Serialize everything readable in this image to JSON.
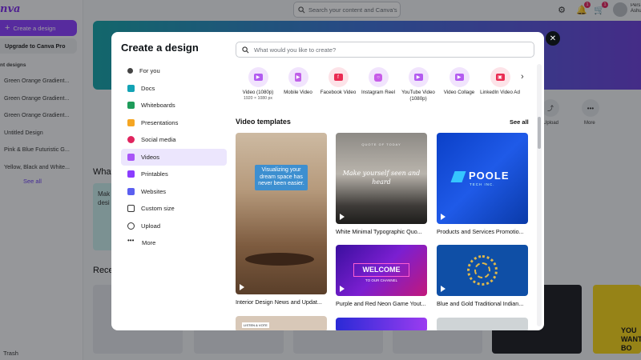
{
  "app": {
    "logo_text": "nva",
    "create_button": "Create a design",
    "upgrade_button": "Upgrade to Canva Pro",
    "recent_header": "nt designs",
    "recent_items": [
      "Green Orange Gradient...",
      "Green Orange Gradient...",
      "Green Orange Gradient...",
      "Untitled Design",
      "Pink & Blue Futuristic G...",
      "Yellow, Black and White..."
    ],
    "see_all": "See all",
    "trash": "Trash",
    "search_placeholder": "Search your content and Canva's",
    "notification_badges": [
      "1",
      "1"
    ],
    "account_name": "Pers\nAshu",
    "section_what": "What",
    "section_recent": "Rece",
    "what_card_text": "Mak\ndesi",
    "bg_shortcuts": [
      "Upload",
      "More"
    ],
    "yellow_card_text": "YOU\nWANT\nBO"
  },
  "modal": {
    "title": "Create a design",
    "search_placeholder": "What would you like to create?",
    "nav": [
      {
        "label": "For you",
        "icon": "sparkle-icon",
        "color": "#444444",
        "active": false
      },
      {
        "label": "Docs",
        "icon": "docs-icon",
        "color": "#13a3b5",
        "active": false
      },
      {
        "label": "Whiteboards",
        "icon": "whiteboard-icon",
        "color": "#1e9c5a",
        "active": false
      },
      {
        "label": "Presentations",
        "icon": "presentation-icon",
        "color": "#f5a623",
        "active": false
      },
      {
        "label": "Social media",
        "icon": "social-media-icon",
        "color": "#e0245e",
        "active": false
      },
      {
        "label": "Videos",
        "icon": "video-icon",
        "color": "#a855f7",
        "active": true
      },
      {
        "label": "Printables",
        "icon": "printer-icon",
        "color": "#8b3dff",
        "active": false
      },
      {
        "label": "Websites",
        "icon": "website-icon",
        "color": "#5b5ff0",
        "active": false
      },
      {
        "label": "Custom size",
        "icon": "custom-size-icon",
        "color": "#333333",
        "active": false
      },
      {
        "label": "Upload",
        "icon": "upload-icon",
        "color": "#333333",
        "active": false
      },
      {
        "label": "More",
        "icon": "more-icon",
        "color": "#333333",
        "active": false
      }
    ],
    "tiles": [
      {
        "label": "Video (1080p)",
        "sub": "1920 × 1080 px",
        "icon": "video-1080p-icon",
        "color": "#b25cf0"
      },
      {
        "label": "Mobile Video",
        "sub": "",
        "icon": "mobile-video-icon",
        "color": "#c060e8"
      },
      {
        "label": "Facebook Video",
        "sub": "",
        "icon": "facebook-video-icon",
        "color": "#ea2b52"
      },
      {
        "label": "Instagram Reel",
        "sub": "",
        "icon": "instagram-reel-icon",
        "color": "#c75ce8"
      },
      {
        "label": "YouTube Video (1080p)",
        "sub": "",
        "icon": "youtube-video-icon",
        "color": "#b45cf0"
      },
      {
        "label": "Video Collage",
        "sub": "",
        "icon": "video-collage-icon",
        "color": "#b45cf0"
      },
      {
        "label": "LinkedIn Video Ad",
        "sub": "",
        "icon": "linkedin-video-icon",
        "color": "#ea2b52"
      }
    ],
    "section_title": "Video templates",
    "see_all": "See all",
    "templates": [
      {
        "caption": "Interior Design News and Updat...",
        "overlay": "Visualizing your dream space has never been easier."
      },
      {
        "caption": "White Minimal Typographic Quo...",
        "overlay": "Make yourself seen and heard",
        "kicker": "QUOTE OF TODAY"
      },
      {
        "caption": "Products and Services Promotio...",
        "overlay": "POOLE",
        "sub": "TECH INC."
      },
      {
        "caption": "Purple and Red Neon Game Yout...",
        "overlay": "WELCOME",
        "sub": "TO OUR CHANNEL"
      },
      {
        "caption": "Blue and Gold Traditional Indian...",
        "overlay": "",
        "sub": ""
      }
    ],
    "partial_template_tag": "LISTEN & VOTE"
  }
}
